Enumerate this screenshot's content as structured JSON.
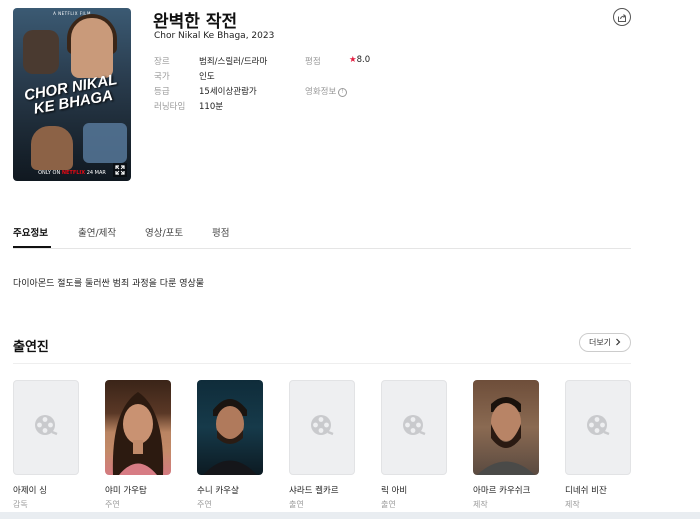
{
  "movie": {
    "title": "완벽한 작전",
    "subtitle": "Chor Nikal Ke Bhaga, 2023",
    "poster": {
      "brand": "A NETFLIX FILM",
      "title": "CHOR NIKAL KE BHAGA",
      "bottom_prefix": "ONLY ON",
      "bottom_brand": "NETFLIX",
      "bottom_date": "24 MAR"
    },
    "info": {
      "genre_label": "장르",
      "genre_value": "범죄/스릴러/드라마",
      "rating_label": "평점",
      "rating_star": "★",
      "rating_value": "8.0",
      "country_label": "국가",
      "country_value": "인도",
      "grade_label": "등급",
      "grade_value": "15세이상관람가",
      "movieinfo_label": "영화정보",
      "movieinfo_icon": "!",
      "runtime_label": "러닝타임",
      "runtime_value": "110분"
    }
  },
  "tabs": [
    {
      "label": "주요정보",
      "active": true
    },
    {
      "label": "출연/제작",
      "active": false
    },
    {
      "label": "영상/포토",
      "active": false
    },
    {
      "label": "평점",
      "active": false
    }
  ],
  "synopsis": "다이아몬드 절도를 둘러싼 범죄 과정을 다룬 영상물",
  "cast_section": {
    "title": "출연진",
    "more_label": "더보기"
  },
  "cast": [
    {
      "name": "아제이 싱",
      "role": "감독",
      "photo": "placeholder"
    },
    {
      "name": "야미 가우탐",
      "role": "주연",
      "photo": "face"
    },
    {
      "name": "수니 카우샬",
      "role": "주연",
      "photo": "face"
    },
    {
      "name": "샤라드 켈카르",
      "role": "출연",
      "photo": "placeholder"
    },
    {
      "name": "릭 아비",
      "role": "출연",
      "photo": "placeholder"
    },
    {
      "name": "아마르 카우쉬크",
      "role": "제작",
      "photo": "face"
    },
    {
      "name": "디네쉬 비잔",
      "role": "제작",
      "photo": "placeholder"
    }
  ],
  "colors": {
    "accent_star": "#e31c3f",
    "netflix_red": "#e50914"
  }
}
